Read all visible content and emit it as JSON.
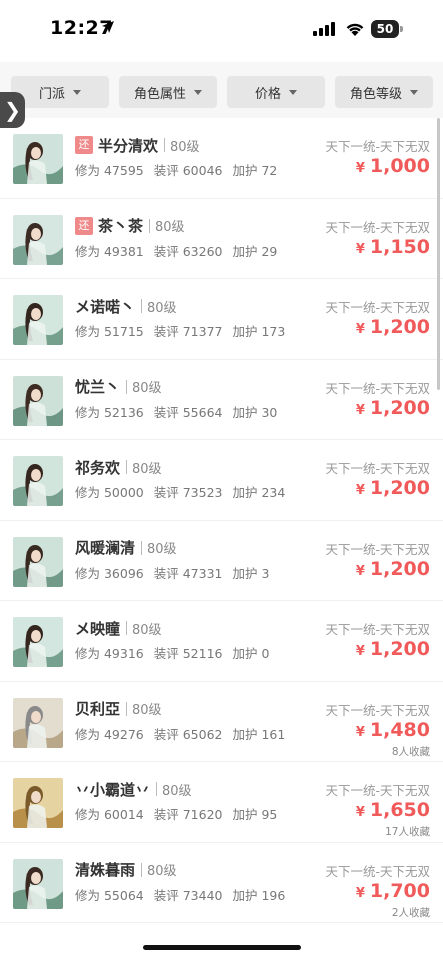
{
  "status_bar": {
    "time": "12:27",
    "battery": "50"
  },
  "filters": [
    {
      "label": "门派"
    },
    {
      "label": "角色属性"
    },
    {
      "label": "价格"
    },
    {
      "label": "角色等级"
    }
  ],
  "side_tab": {
    "glyph": "❯"
  },
  "listings": [
    {
      "name": "半分清欢",
      "badge": "还",
      "level": "80级",
      "stats": [
        "修为 47595",
        "装评 60046",
        "加护 72"
      ],
      "server": "天下一统-天下无双",
      "price": "1,000",
      "currency": "¥",
      "favorites": ""
    },
    {
      "name": "茶丶茶",
      "badge": "还",
      "level": "80级",
      "stats": [
        "修为 49381",
        "装评 63260",
        "加护 29"
      ],
      "server": "天下一统-天下无双",
      "price": "1,150",
      "currency": "¥",
      "favorites": ""
    },
    {
      "name": "メ诺喏丶",
      "badge": "",
      "level": "80级",
      "stats": [
        "修为 51715",
        "装评 71377",
        "加护 173"
      ],
      "server": "天下一统-天下无双",
      "price": "1,200",
      "currency": "¥",
      "favorites": ""
    },
    {
      "name": "忧兰丶",
      "badge": "",
      "level": "80级",
      "stats": [
        "修为 52136",
        "装评 55664",
        "加护 30"
      ],
      "server": "天下一统-天下无双",
      "price": "1,200",
      "currency": "¥",
      "favorites": ""
    },
    {
      "name": "祁务欢",
      "badge": "",
      "level": "80级",
      "stats": [
        "修为 50000",
        "装评 73523",
        "加护 234"
      ],
      "server": "天下一统-天下无双",
      "price": "1,200",
      "currency": "¥",
      "favorites": ""
    },
    {
      "name": "风暖澜清",
      "badge": "",
      "level": "80级",
      "stats": [
        "修为 36096",
        "装评 47331",
        "加护 3"
      ],
      "server": "天下一统-天下无双",
      "price": "1,200",
      "currency": "¥",
      "favorites": ""
    },
    {
      "name": "メ映瞳",
      "badge": "",
      "level": "80级",
      "stats": [
        "修为 49316",
        "装评 52116",
        "加护 0"
      ],
      "server": "天下一统-天下无双",
      "price": "1,200",
      "currency": "¥",
      "favorites": ""
    },
    {
      "name": "贝利亞",
      "badge": "",
      "level": "80级",
      "stats": [
        "修为 49276",
        "装评 65062",
        "加护 161"
      ],
      "server": "天下一统-天下无双",
      "price": "1,480",
      "currency": "¥",
      "favorites": "8人收藏"
    },
    {
      "name": "丷小霸道丷",
      "badge": "",
      "level": "80级",
      "stats": [
        "修为 60014",
        "装评 71620",
        "加护 95"
      ],
      "server": "天下一统-天下无双",
      "price": "1,650",
      "currency": "¥",
      "favorites": "17人收藏"
    },
    {
      "name": "清姝暮雨",
      "badge": "",
      "level": "80级",
      "stats": [
        "修为 55064",
        "装评 73440",
        "加护 196"
      ],
      "server": "天下一统-天下无双",
      "price": "1,700",
      "currency": "¥",
      "favorites": "2人收藏"
    }
  ],
  "colors": {
    "price": "#f05a5a",
    "badge": "#f08a8a",
    "filter_bg": "#e6e6e6"
  }
}
